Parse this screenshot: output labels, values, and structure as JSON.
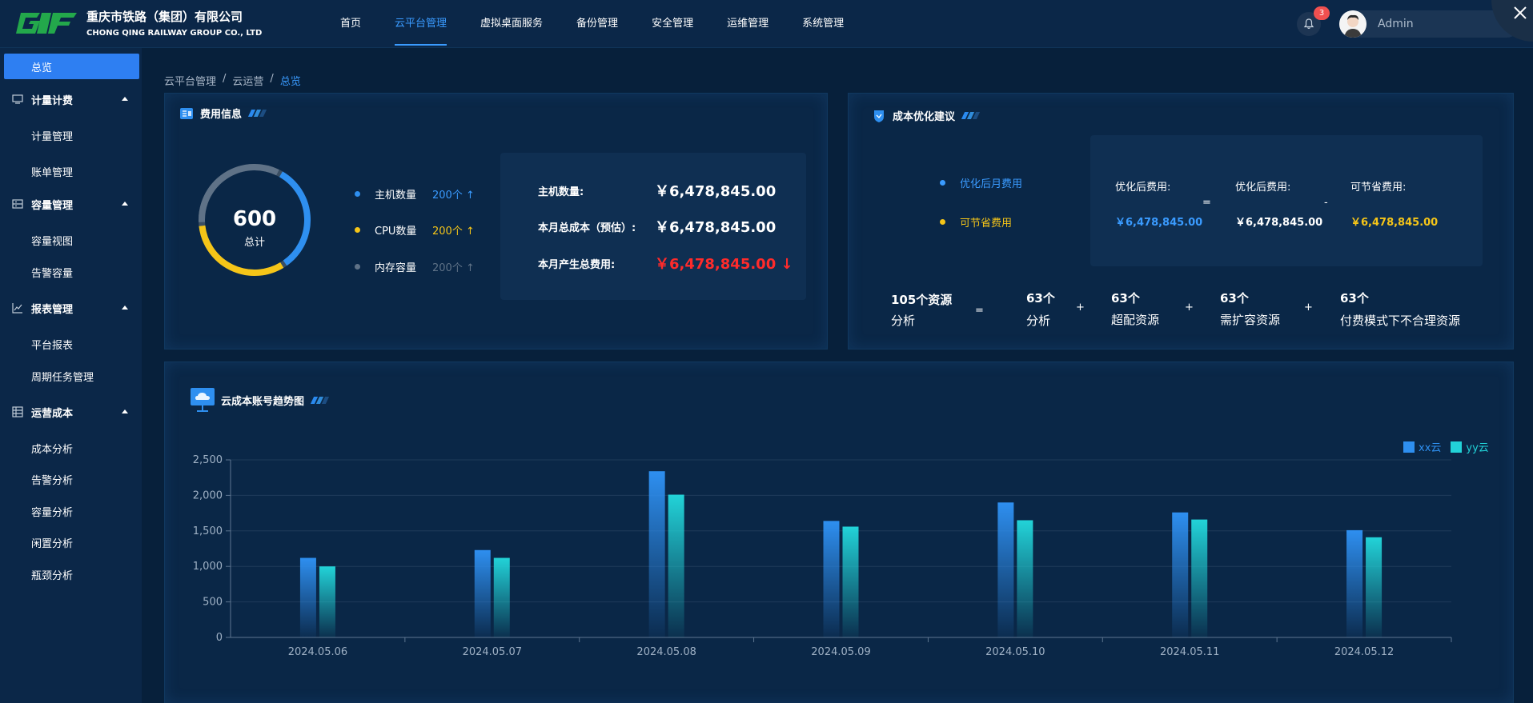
{
  "header": {
    "company_cn": "重庆市铁路（集团）有限公司",
    "company_en": "CHONG QING RAILWAY GROUP CO., LTD",
    "nav": [
      {
        "label": "首页",
        "active": false
      },
      {
        "label": "云平台管理",
        "active": true
      },
      {
        "label": "虚拟桌面服务",
        "active": false
      },
      {
        "label": "备份管理",
        "active": false
      },
      {
        "label": "安全管理",
        "active": false
      },
      {
        "label": "运维管理",
        "active": false
      },
      {
        "label": "系统管理",
        "active": false
      }
    ],
    "notification_count": "3",
    "username": "Admin"
  },
  "sidebar": {
    "items": [
      {
        "label": "总览",
        "type": "active",
        "icon": ""
      },
      {
        "label": "计量计费",
        "type": "group",
        "icon": "monitor-icon"
      },
      {
        "label": "计量管理",
        "type": "sub",
        "icon": ""
      },
      {
        "label": "账单管理",
        "type": "sub",
        "icon": ""
      },
      {
        "label": "容量管理",
        "type": "group",
        "icon": "storage-icon"
      },
      {
        "label": "容量视图",
        "type": "sub",
        "icon": ""
      },
      {
        "label": "告警容量",
        "type": "sub",
        "icon": ""
      },
      {
        "label": "报表管理",
        "type": "group",
        "icon": "line-chart-icon"
      },
      {
        "label": "平台报表",
        "type": "sub",
        "icon": ""
      },
      {
        "label": "周期任务管理",
        "type": "sub",
        "icon": ""
      },
      {
        "label": "运营成本",
        "type": "group",
        "icon": "table-icon"
      },
      {
        "label": "成本分析",
        "type": "sub",
        "icon": ""
      },
      {
        "label": "告警分析",
        "type": "sub",
        "icon": ""
      },
      {
        "label": "容量分析",
        "type": "sub",
        "icon": ""
      },
      {
        "label": "闲置分析",
        "type": "sub",
        "icon": ""
      },
      {
        "label": "瓶颈分析",
        "type": "sub",
        "icon": ""
      }
    ]
  },
  "breadcrumb": [
    "云平台管理",
    "云运营",
    "总览"
  ],
  "fee_panel": {
    "title": "费用信息",
    "total_value": "600",
    "total_label": "总计",
    "ring_share": {
      "blue": 0.33,
      "yellow": 0.33,
      "gray": 0.34
    },
    "legend": [
      {
        "label": "主机数量",
        "value": "200个 ↑",
        "color": "#2e8ff0"
      },
      {
        "label": "CPU数量",
        "value": "200个 ↑",
        "color": "#f5c518"
      },
      {
        "label": "内存容量",
        "value": "200个 ↑",
        "color": "#5f7287"
      }
    ],
    "details": [
      {
        "key": "主机数量:",
        "value": "￥6,478,845.00",
        "color": "#ffffff"
      },
      {
        "key": "本月总成本（预估）:",
        "value": "￥6,478,845.00",
        "color": "#ffffff"
      },
      {
        "key": "本月产生总费用:",
        "value": "￥6,478,845.00 ↓",
        "color": "#ff2b2b"
      }
    ]
  },
  "optimize_panel": {
    "title": "成本优化建议",
    "legend": [
      {
        "label": "优化后月费用",
        "color": "#3a9bff"
      },
      {
        "label": "可节省费用",
        "color": "#f5c518"
      }
    ],
    "columns": [
      {
        "label": "优化后费用:",
        "value": "￥6,478,845.00",
        "color": "#3a9bff"
      },
      {
        "label": "优化后费用:",
        "value": "￥6,478,845.00",
        "color": "#ffffff"
      },
      {
        "label": "可节省费用:",
        "value": "￥6,478,845.00",
        "color": "#f5c518"
      }
    ],
    "operators": [
      "=",
      "-"
    ],
    "resources": [
      {
        "top": "105个资源",
        "bottom": "分析"
      },
      {
        "top": "63个",
        "bottom": "分析"
      },
      {
        "top": "63个",
        "bottom": "超配资源"
      },
      {
        "top": "63个",
        "bottom": "需扩容资源"
      },
      {
        "top": "63个",
        "bottom": "付费模式下不合理资源"
      }
    ],
    "resource_ops": [
      "=",
      "+",
      "+",
      "+"
    ]
  },
  "trend_panel": {
    "title": "云成本账号趋势图"
  },
  "chart_data": {
    "type": "bar",
    "categories": [
      "2024.05.06",
      "2024.05.07",
      "2024.05.08",
      "2024.05.09",
      "2024.05.10",
      "2024.05.11",
      "2024.05.12"
    ],
    "series": [
      {
        "name": "xx云",
        "values": [
          1120,
          1230,
          2340,
          1640,
          1900,
          1760,
          1510
        ],
        "color": "#2e8ff0"
      },
      {
        "name": "yy云",
        "values": [
          1000,
          1120,
          2010,
          1560,
          1650,
          1660,
          1410
        ],
        "color": "#22d3d8"
      }
    ],
    "yticks": [
      "0",
      "500",
      "1,000",
      "1,500",
      "2,000",
      "2,500"
    ],
    "ylim": [
      0,
      2500
    ],
    "legend_position": "top-right",
    "grid": true,
    "title": "",
    "xlabel": "",
    "ylabel": ""
  }
}
